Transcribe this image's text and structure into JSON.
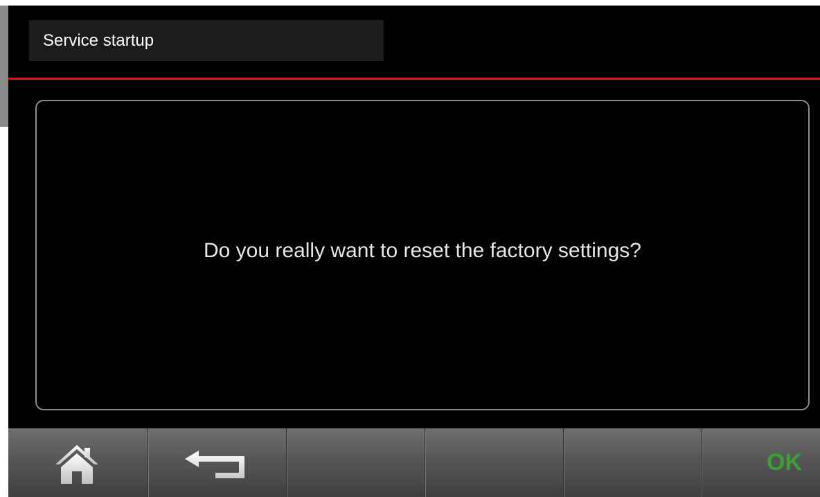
{
  "header": {
    "title": "Service startup",
    "accent_color": "#e3101f"
  },
  "dialog": {
    "message": "Do you really want to reset the factory settings?"
  },
  "toolbar": {
    "buttons": [
      {
        "icon": "home-icon"
      },
      {
        "icon": "back-arrow-icon"
      },
      {
        "label": ""
      },
      {
        "label": ""
      },
      {
        "label": ""
      },
      {
        "label": "OK",
        "color": "#3aa136"
      }
    ]
  }
}
